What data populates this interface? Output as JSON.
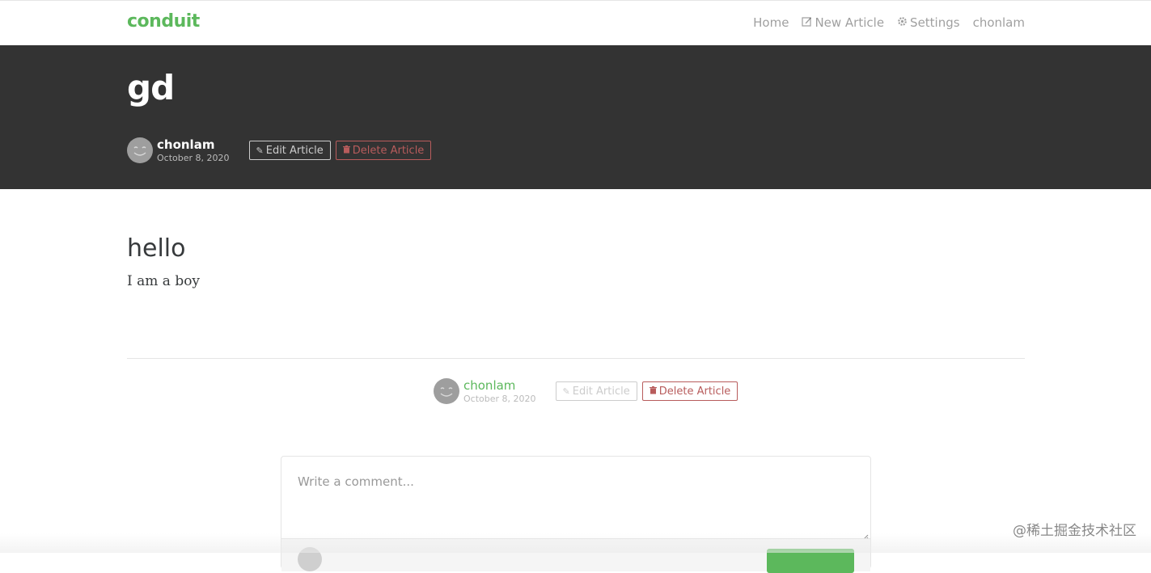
{
  "navbar": {
    "brand": "conduit",
    "items": [
      {
        "label": "Home",
        "icon": ""
      },
      {
        "label": "New Article",
        "icon": "edit-icon"
      },
      {
        "label": "Settings",
        "icon": "gear-icon"
      },
      {
        "label": "chonlam",
        "icon": ""
      }
    ]
  },
  "article": {
    "title": "gd",
    "author": "chonlam",
    "date": "October 8, 2020",
    "edit_label": "Edit Article",
    "delete_label": "Delete Article",
    "body_heading": "hello",
    "body_text": "I am a boy"
  },
  "comment": {
    "placeholder": "Write a comment..."
  },
  "watermark": "@稀土掘金技术社区",
  "colors": {
    "brand": "#5cb85c",
    "banner": "#333333",
    "danger": "#b85c5c"
  }
}
